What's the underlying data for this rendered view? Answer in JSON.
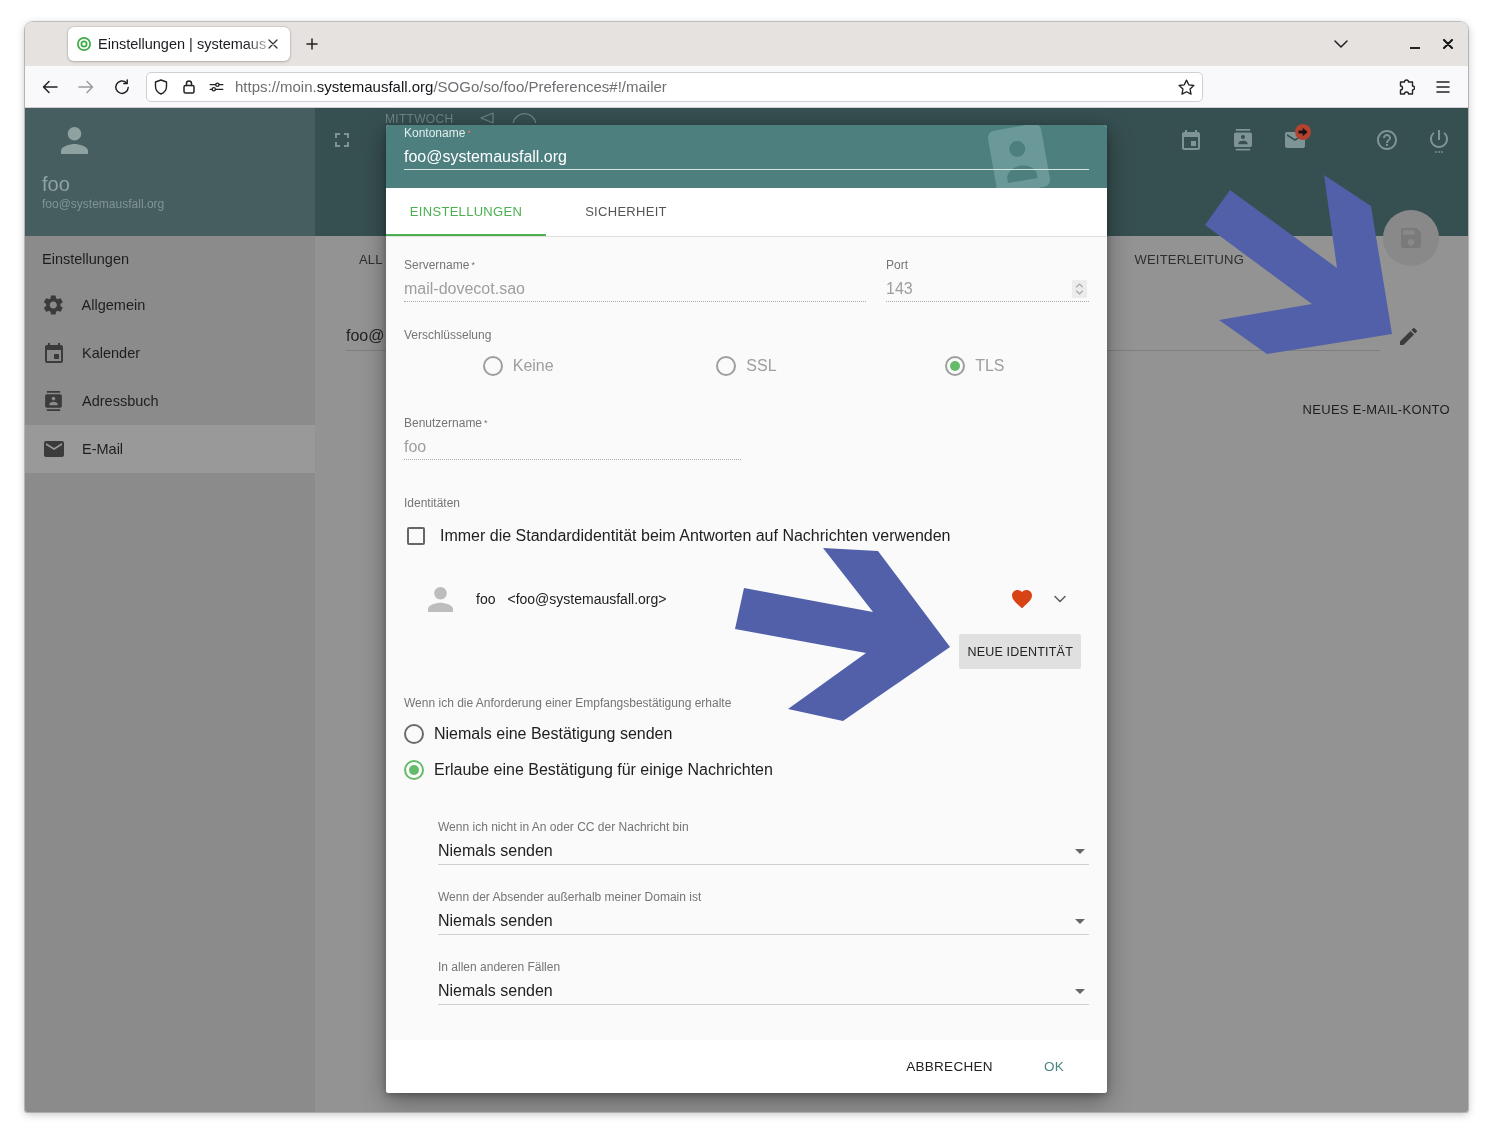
{
  "browser": {
    "tabs": [
      {
        "title": "Einstellungen | systemaus",
        "selected": true
      }
    ],
    "url": {
      "prefix": "https://moin.",
      "domain": "systemausfall.org",
      "path": "/SOGo/so/foo/Preferences#!/mailer"
    }
  },
  "sidebar": {
    "user_name": "foo",
    "user_email": "foo@systemausfall.org",
    "title": "Einstellungen",
    "items": [
      {
        "kind": "general",
        "label": "Allgemein",
        "selected": false
      },
      {
        "kind": "calendar",
        "label": "Kalender",
        "selected": false
      },
      {
        "kind": "addressbook",
        "label": "Adressbuch",
        "selected": false
      },
      {
        "kind": "mail",
        "label": "E-Mail",
        "selected": true
      }
    ]
  },
  "header": {
    "day": "MITTWOCH"
  },
  "main": {
    "tabs": [
      {
        "label": "ALL",
        "selected": false
      },
      {
        "label": "WEITERLEITUNG",
        "selected": false
      }
    ],
    "account": "foo@",
    "new_account_button": "NEUES E-MAIL-KONTO"
  },
  "dialog": {
    "account_name": {
      "label": "Kontoname",
      "required_mark": "*",
      "value": "foo@systemausfall.org"
    },
    "tabs": [
      {
        "label": "EINSTELLUNGEN",
        "selected": true
      },
      {
        "label": "SICHERHEIT",
        "selected": false
      }
    ],
    "server": {
      "label": "Servername",
      "required_mark": "*",
      "value": "mail-dovecot.sao",
      "disabled": true
    },
    "port": {
      "label": "Port",
      "value": "143",
      "disabled": true
    },
    "encryption": {
      "label": "Verschlüsselung",
      "disabled": true,
      "options": [
        {
          "label": "Keine",
          "selected": false
        },
        {
          "label": "SSL",
          "selected": false
        },
        {
          "label": "TLS",
          "selected": true
        }
      ]
    },
    "username": {
      "label": "Benutzername",
      "required_mark": "*",
      "value": "foo",
      "disabled": true
    },
    "identities": {
      "label": "Identitäten",
      "always_default": {
        "label": "Immer die Standardidentität beim Antworten auf Nachrichten verwenden",
        "checked": false
      },
      "items": [
        {
          "name": "foo",
          "email": "<foo@systemausfall.org>",
          "default": true
        }
      ],
      "new_button": "NEUE IDENTITÄT"
    },
    "receipts": {
      "label": "Wenn ich die Anforderung einer Empfangsbestätigung erhalte",
      "options": [
        {
          "label": "Niemals eine Bestätigung senden",
          "selected": false
        },
        {
          "label": "Erlaube eine Bestätigung für einige Nachrichten",
          "selected": true
        }
      ],
      "selects": [
        {
          "label": "Wenn ich nicht in An oder CC der Nachricht bin",
          "value": "Niemals senden"
        },
        {
          "label": "Wenn der Absender außerhalb meiner Domain ist",
          "value": "Niemals senden"
        },
        {
          "label": "In allen anderen Fällen",
          "value": "Niemals senden"
        }
      ]
    },
    "buttons": [
      {
        "kind": "cancel",
        "label": "ABBRECHEN"
      },
      {
        "kind": "confirm",
        "label": "OK"
      }
    ]
  }
}
